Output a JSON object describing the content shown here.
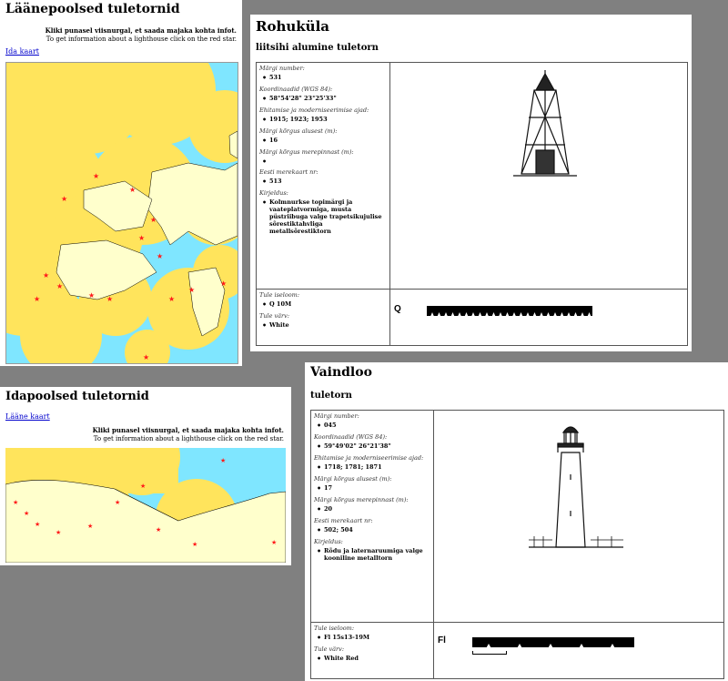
{
  "west_window": {
    "title": "Läänepoolsed tuletornid",
    "link": "Ida kaart",
    "instruction_et": "Kliki punasel viisnurgal, et saada majaka kohta infot.",
    "instruction_en": "To get information about a lighthouse click on the red star."
  },
  "east_window": {
    "title": "Idapoolsed tuletornid",
    "link": "Lääne kaart",
    "instruction_et": "Kliki punasel viisnurgal, et saada majaka kohta infot.",
    "instruction_en": "To get information about a lighthouse click on the red star."
  },
  "rohukyla": {
    "title": "Rohuküla",
    "subtitle": "liitsihi alumine tuletorn",
    "labels": {
      "number": "Märgi number:",
      "coords": "Koordinaadid (WGS 84):",
      "built": "Ehitamise ja moderniseerimise ajad:",
      "height_ground": "Märgi kõrgus alusest (m):",
      "height_sea": "Märgi kõrgus merepinnast (m):",
      "chart": "Eesti merekaart nr:",
      "desc": "Kirjeldus:",
      "character": "Tule iseloom:",
      "color": "Tule värv:"
    },
    "number": "531",
    "coords": "58°54'28\" 23°25'33\"",
    "built": "1915; 1923; 1953",
    "height_ground": "16",
    "height_sea": "",
    "chart": "513",
    "desc": "Kolmnurkse topimärgi ja vaateplatvormiga, musta püstriibuga valge trapetsikujulise sõrestiktahvliga metallsõrestiktorn",
    "character": "Q 10M",
    "color": "White",
    "light_code": "Q"
  },
  "vaindloo": {
    "title": "Vaindloo",
    "subtitle": "tuletorn",
    "labels": {
      "number": "Märgi number:",
      "coords": "Koordinaadid (WGS 84):",
      "built": "Ehitamise ja moderniseerimise ajad:",
      "height_ground": "Märgi kõrgus alusest (m):",
      "height_sea": "Märgi kõrgus merepinnast (m):",
      "chart": "Eesti merekaart nr:",
      "desc": "Kirjeldus:",
      "character": "Tule iseloom:",
      "color": "Tule värv:"
    },
    "number": "045",
    "coords": "59°49'02\" 26°21'38\"",
    "built": "1718; 1781; 1871",
    "height_ground": "17",
    "height_sea": "20",
    "chart": "502; 504",
    "desc": "Rõdu ja laternaruumiga valge kooniline metalltorn",
    "character": "Fl 15s13-19M",
    "color": "White Red",
    "light_code": "Fl"
  },
  "colors": {
    "sea": "#7fe6ff",
    "coverage": "#ffe45c",
    "land": "#ffffcc",
    "star": "#ff1a1a"
  }
}
